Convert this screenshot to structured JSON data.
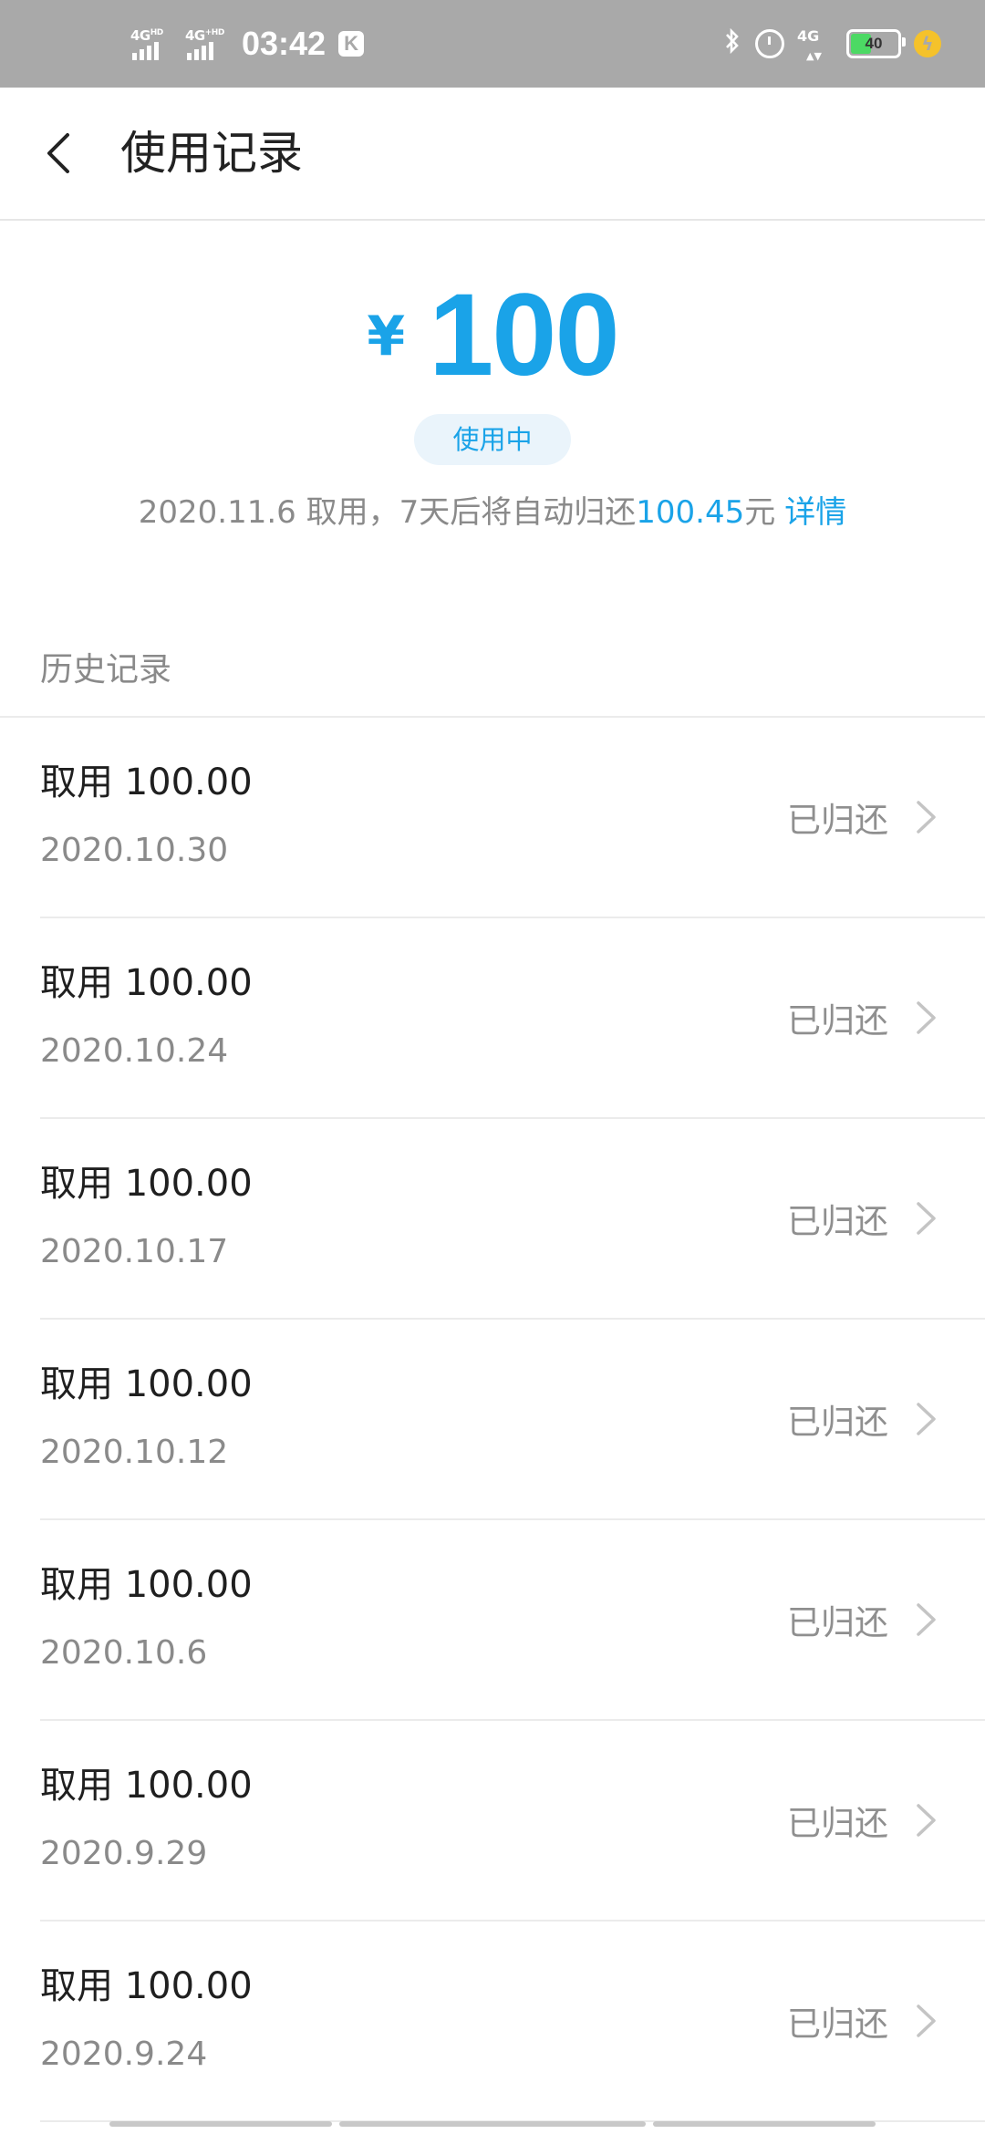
{
  "status_bar": {
    "sim1_network": "4G HD",
    "sim2_network": "4G+ HD",
    "time": "03:42",
    "app_badge": "K",
    "bluetooth": "bluetooth-icon",
    "alarm": "alarm-icon",
    "data_network": "4G",
    "battery_level": "40",
    "battery_fraction": 0.4,
    "charging": "charging-icon"
  },
  "header": {
    "back_icon": "back-arrow-icon",
    "title": "使用记录"
  },
  "summary": {
    "currency_symbol": "¥",
    "amount": "100",
    "status": "使用中",
    "info_prefix": "2020.11.6 取用，7天后将自动归还",
    "info_amount": "100.45",
    "info_suffix": "元",
    "detail_link": "详情"
  },
  "history": {
    "heading": "历史记录",
    "records": [
      {
        "title": "取用 100.00",
        "date": "2020.10.30",
        "status": "已归还"
      },
      {
        "title": "取用 100.00",
        "date": "2020.10.24",
        "status": "已归还"
      },
      {
        "title": "取用 100.00",
        "date": "2020.10.17",
        "status": "已归还"
      },
      {
        "title": "取用 100.00",
        "date": "2020.10.12",
        "status": "已归还"
      },
      {
        "title": "取用 100.00",
        "date": "2020.10.6",
        "status": "已归还"
      },
      {
        "title": "取用 100.00",
        "date": "2020.9.29",
        "status": "已归还"
      },
      {
        "title": "取用 100.00",
        "date": "2020.9.24",
        "status": "已归还"
      }
    ]
  },
  "colors": {
    "accent": "#1aa3e8",
    "status_bar_bg": "#a9a9a9",
    "text_primary": "#1f1f1f",
    "text_secondary": "#8a8a8a",
    "pill_bg": "#eaf4fb",
    "battery_fill": "#4cd964"
  }
}
